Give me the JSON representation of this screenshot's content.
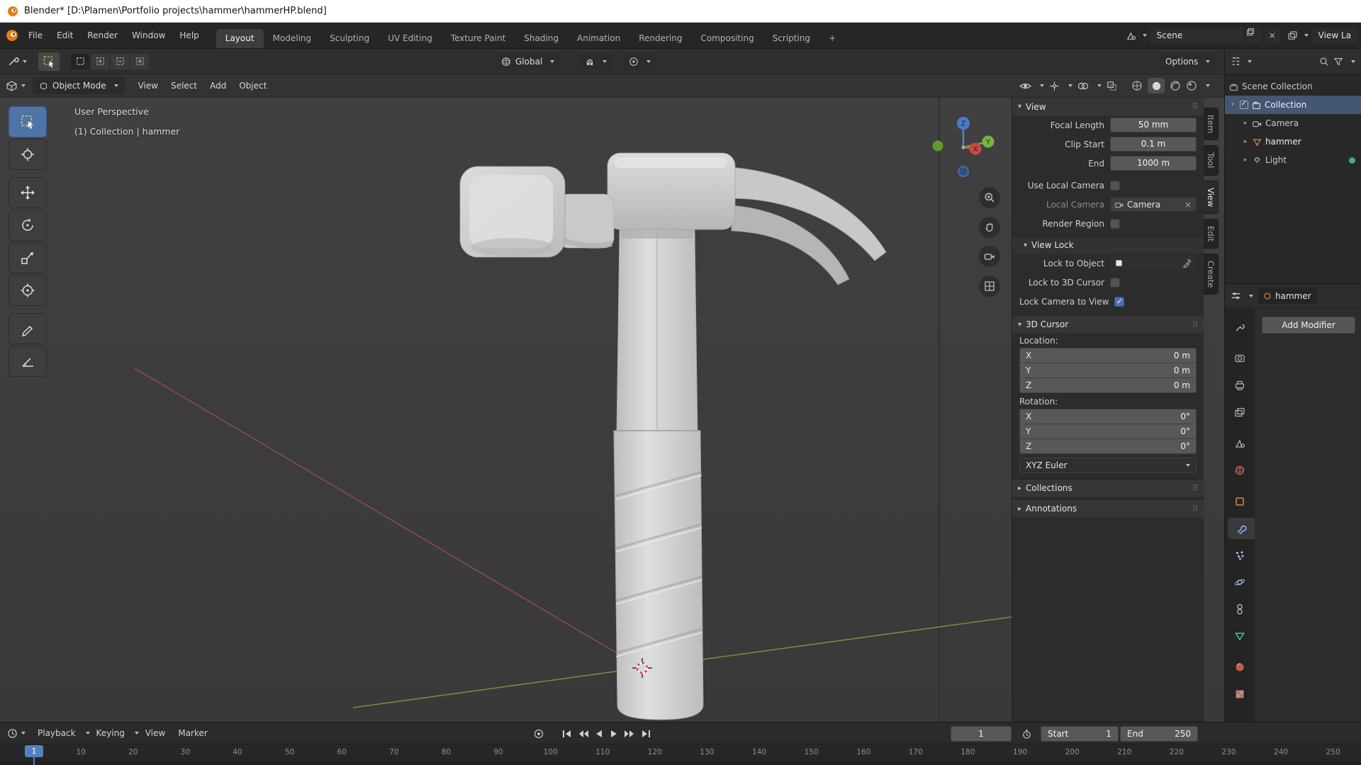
{
  "window": {
    "title": "Blender* [D:\\Plamen\\Portfolio projects\\hammer\\hammerHP.blend]"
  },
  "topbar": {
    "menus": [
      "File",
      "Edit",
      "Render",
      "Window",
      "Help"
    ],
    "workspaces": [
      "Layout",
      "Modeling",
      "Sculpting",
      "UV Editing",
      "Texture Paint",
      "Shading",
      "Animation",
      "Rendering",
      "Compositing",
      "Scripting"
    ],
    "active_workspace": "Layout",
    "add_workspace_label": "+",
    "scene_name": "Scene",
    "view_layer_name": "View La"
  },
  "tool_settings": {
    "orientation": "Global",
    "options_label": "Options"
  },
  "viewport": {
    "mode": "Object Mode",
    "menus": [
      "View",
      "Select",
      "Add",
      "Object"
    ],
    "overlay_perspective": "User Perspective",
    "overlay_context": "(1) Collection | hammer"
  },
  "sidebar": {
    "tabs": [
      "Item",
      "Tool",
      "View",
      "Edit",
      "Create"
    ],
    "active_tab": "View",
    "view": {
      "title": "View",
      "rows": {
        "focal_label": "Focal Length",
        "focal_value": "50 mm",
        "clip_label": "Clip Start",
        "clip_value": "0.1 m",
        "end_label": "End",
        "end_value": "1000 m",
        "use_local_label": "Use Local Camera",
        "local_camera_label": "Local Camera",
        "local_camera_value": "Camera",
        "render_region_label": "Render Region"
      }
    },
    "view_lock": {
      "title": "View Lock",
      "lock_object_label": "Lock to Object",
      "lock_cursor_label": "Lock to 3D Cursor",
      "lock_camera_label": "Lock Camera to View"
    },
    "cursor3d": {
      "title": "3D Cursor",
      "location_label": "Location:",
      "rotation_label": "Rotation:",
      "loc_x_axis": "X",
      "loc_x": "0 m",
      "loc_y_axis": "Y",
      "loc_y": "0 m",
      "loc_z_axis": "Z",
      "loc_z": "0 m",
      "rot_x_axis": "X",
      "rot_x": "0°",
      "rot_y_axis": "Y",
      "rot_y": "0°",
      "rot_z_axis": "Z",
      "rot_z": "0°",
      "rotation_order": "XYZ Euler"
    },
    "collections_title": "Collections",
    "annotations_title": "Annotations"
  },
  "outliner": {
    "items": [
      {
        "label": "Scene Collection"
      },
      {
        "label": "Collection"
      },
      {
        "label": "Camera"
      },
      {
        "label": "hammer"
      },
      {
        "label": "Light"
      }
    ]
  },
  "properties": {
    "breadcrumb": "hammer",
    "add_modifier_label": "Add Modifier"
  },
  "timeline": {
    "menus": [
      "Playback",
      "Keying",
      "View",
      "Marker"
    ],
    "current_frame": "1",
    "start_label": "Start",
    "start_value": "1",
    "end_label": "End",
    "end_value": "250",
    "frames": [
      1,
      10,
      20,
      30,
      40,
      50,
      60,
      70,
      80,
      90,
      100,
      110,
      120,
      130,
      140,
      150,
      160,
      170,
      180,
      190,
      200,
      210,
      220,
      230,
      240,
      250
    ]
  },
  "colors": {
    "accent": "#4772b3",
    "selection": "#435672",
    "object_orange": "#e0883a"
  }
}
